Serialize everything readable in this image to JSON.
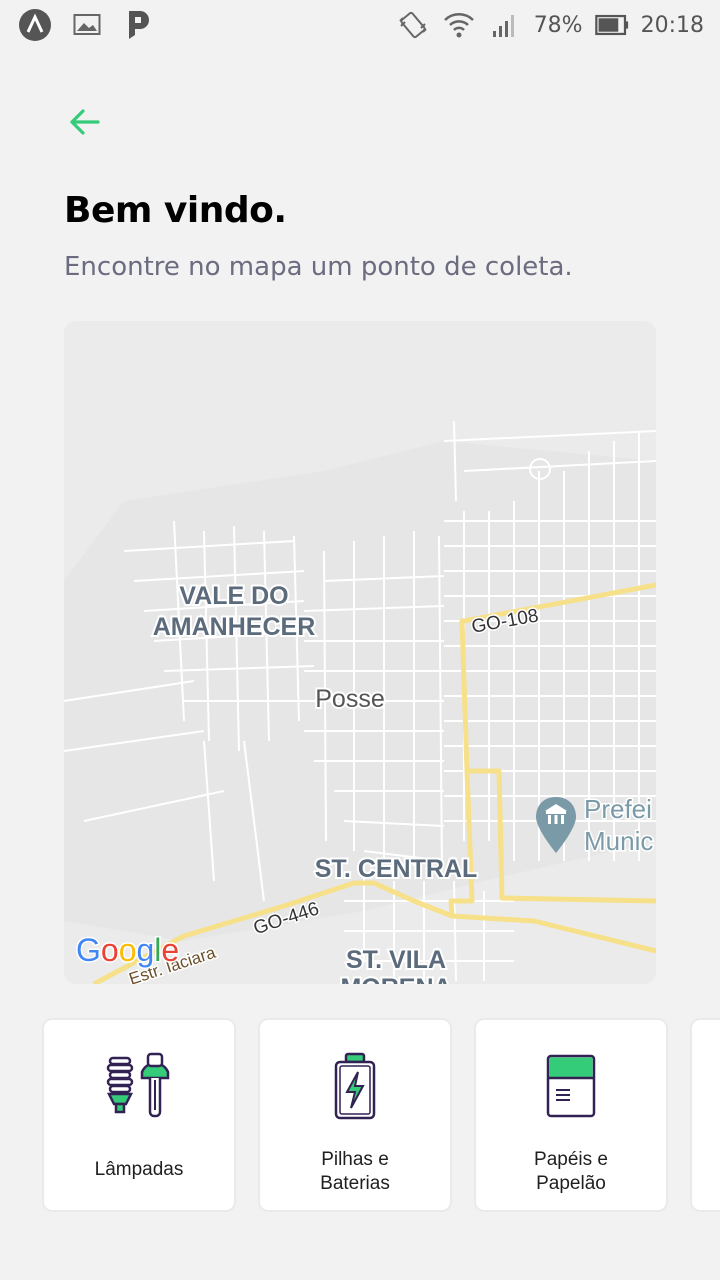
{
  "status_bar": {
    "battery_percent": "78%",
    "time": "20:18",
    "icons": [
      "app-a-icon",
      "image-icon",
      "parking-app-icon",
      "vibrate-icon",
      "wifi-icon",
      "signal-icon",
      "battery-icon"
    ]
  },
  "header": {
    "back_icon": "arrow-left-icon",
    "title": "Bem vindo.",
    "subtitle": "Encontre no mapa um ponto de coleta."
  },
  "map": {
    "labels": {
      "vale_line1": "VALE DO",
      "vale_line2": "AMANHECER",
      "posse": "Posse",
      "st_central": "ST. CENTRAL",
      "st_vila": "ST. VILA",
      "morena": "MORENA",
      "go108": "GO-108",
      "go446": "GO-446",
      "estr": "Estr. Iaciara",
      "pref_line1": "Prefei",
      "pref_line2": "Munic",
      "google": "Google"
    },
    "colors": {
      "background": "#ebebeb",
      "road": "#ffffff",
      "highway": "#f7e08a",
      "label": "#5b6b7c"
    }
  },
  "items": [
    {
      "label": "Lâmpadas",
      "icon": "lamp-icon"
    },
    {
      "label_line1": "Pilhas e",
      "label_line2": "Baterias",
      "icon": "battery-icon"
    },
    {
      "label_line1": "Papéis e",
      "label_line2": "Papelão",
      "icon": "paper-icon"
    }
  ],
  "accent_color": "#34cb79"
}
